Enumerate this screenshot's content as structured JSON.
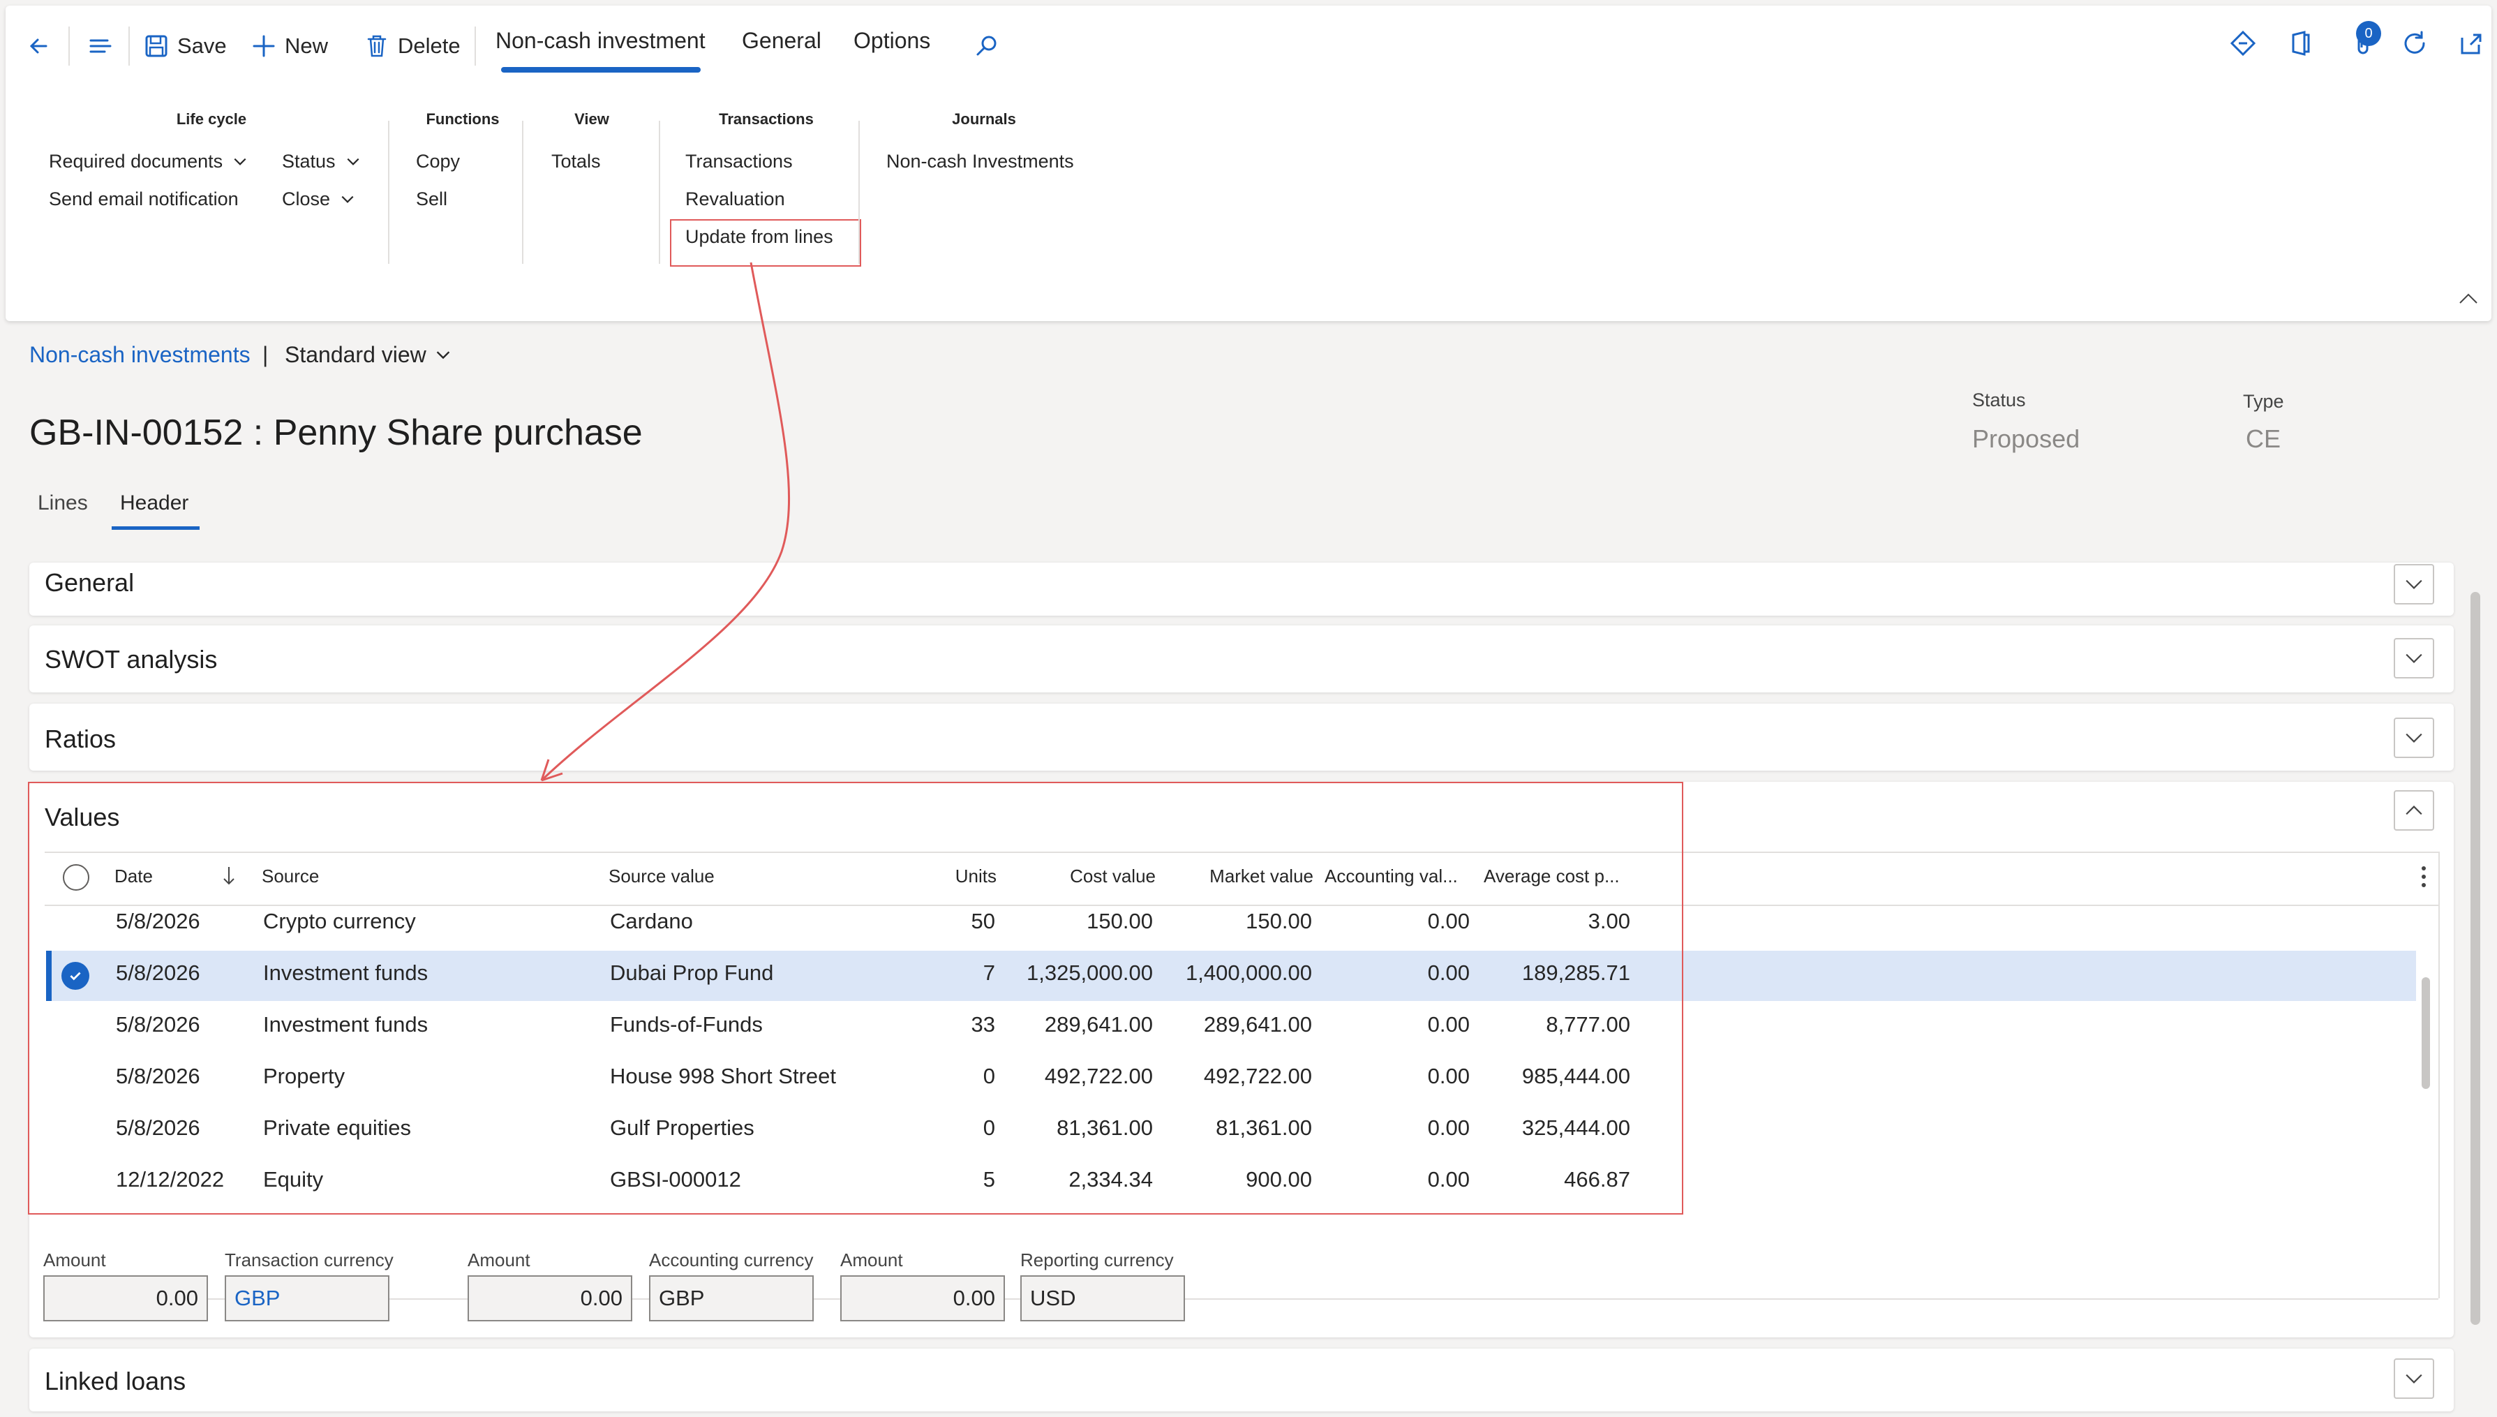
{
  "toolbar": {
    "save": "Save",
    "new": "New",
    "delete": "Delete",
    "tabs": [
      "Non-cash investment",
      "General",
      "Options"
    ],
    "notification_count": "0"
  },
  "ribbon": {
    "groups": {
      "lifecycle": {
        "title": "Life cycle",
        "items": [
          "Required documents",
          "Send email notification",
          "Status",
          "Close"
        ]
      },
      "functions": {
        "title": "Functions",
        "items": [
          "Copy",
          "Sell"
        ]
      },
      "view": {
        "title": "View",
        "items": [
          "Totals"
        ]
      },
      "transactions": {
        "title": "Transactions",
        "items": [
          "Transactions",
          "Revaluation",
          "Update from lines"
        ]
      },
      "journals": {
        "title": "Journals",
        "items": [
          "Non-cash Investments"
        ]
      }
    }
  },
  "breadcrumb": {
    "link": "Non-cash investments",
    "separator": "|",
    "view": "Standard view"
  },
  "page": {
    "title": "GB-IN-00152 : Penny Share purchase",
    "status_label": "Status",
    "status_value": "Proposed",
    "type_label": "Type",
    "type_value": "CE",
    "subtabs": [
      "Lines",
      "Header"
    ]
  },
  "fasttabs": {
    "general": "General",
    "swot": "SWOT analysis",
    "ratios": "Ratios",
    "values": "Values",
    "linked_loans": "Linked loans"
  },
  "grid": {
    "columns": [
      "Date",
      "Source",
      "Source value",
      "Units",
      "Cost value",
      "Market value",
      "Accounting val...",
      "Average cost p..."
    ],
    "rows": [
      [
        "5/8/2026",
        "Crypto currency",
        "Cardano",
        "50",
        "150.00",
        "150.00",
        "0.00",
        "3.00"
      ],
      [
        "5/8/2026",
        "Investment funds",
        "Dubai Prop Fund",
        "7",
        "1,325,000.00",
        "1,400,000.00",
        "0.00",
        "189,285.71"
      ],
      [
        "5/8/2026",
        "Investment funds",
        "Funds-of-Funds",
        "33",
        "289,641.00",
        "289,641.00",
        "0.00",
        "8,777.00"
      ],
      [
        "5/8/2026",
        "Property",
        "House 998 Short Street",
        "0",
        "492,722.00",
        "492,722.00",
        "0.00",
        "985,444.00"
      ],
      [
        "5/8/2026",
        "Private equities",
        "Gulf Properties",
        "0",
        "81,361.00",
        "81,361.00",
        "0.00",
        "325,444.00"
      ],
      [
        "12/12/2022",
        "Equity",
        "GBSI-000012",
        "5",
        "2,334.34",
        "900.00",
        "0.00",
        "466.87"
      ]
    ]
  },
  "totals": {
    "amount1_label": "Amount",
    "amount1": "0.00",
    "txn_currency_label": "Transaction currency",
    "txn_currency": "GBP",
    "amount2_label": "Amount",
    "amount2": "0.00",
    "acc_currency_label": "Accounting currency",
    "acc_currency": "GBP",
    "amount3_label": "Amount",
    "amount3": "0.00",
    "rep_currency_label": "Reporting currency",
    "rep_currency": "USD"
  },
  "colors": {
    "accent": "#1a64c4",
    "annotation": "#e05a5a",
    "selected_row": "#dbe6f7"
  }
}
